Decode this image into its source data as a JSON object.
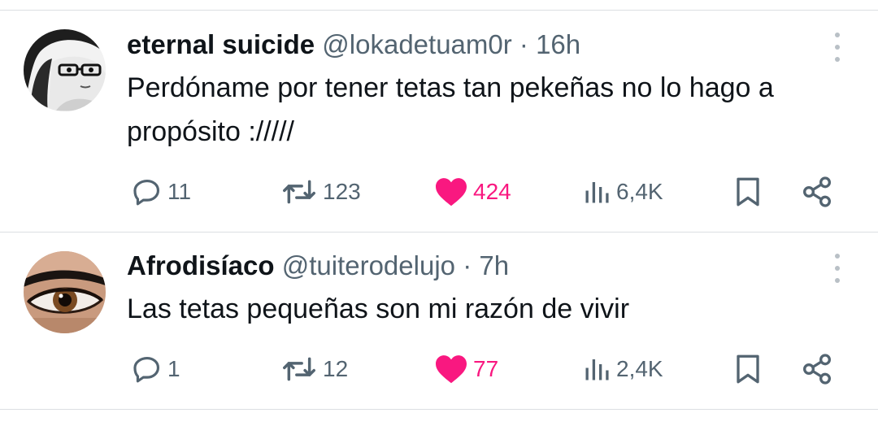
{
  "tweets": [
    {
      "author_name": "eternal suicide",
      "handle": "@lokadetuam0r",
      "separator": "·",
      "time": "16h",
      "text": "Perdóname por tener tetas tan pekeñas no lo hago a propósito ://///",
      "replies": "11",
      "retweets": "123",
      "likes": "424",
      "views": "6,4K",
      "liked": true,
      "avatar_icon": "manga-girl-glasses-avatar"
    },
    {
      "author_name": "Afrodisíaco",
      "handle": "@tuiterodelujo",
      "separator": "·",
      "time": "7h",
      "text": "Las tetas pequeñas son mi razón de vivir",
      "replies": "1",
      "retweets": "12",
      "likes": "77",
      "views": "2,4K",
      "liked": true,
      "avatar_icon": "brown-eye-avatar"
    }
  ],
  "colors": {
    "text": "#0f1419",
    "secondary": "#536471",
    "like": "#f91880",
    "divider": "#dcdfe2"
  },
  "icons": [
    "reply-icon",
    "retweet-icon",
    "like-heart-icon",
    "views-chart-icon",
    "bookmark-icon",
    "share-icon",
    "more-options-icon"
  ]
}
